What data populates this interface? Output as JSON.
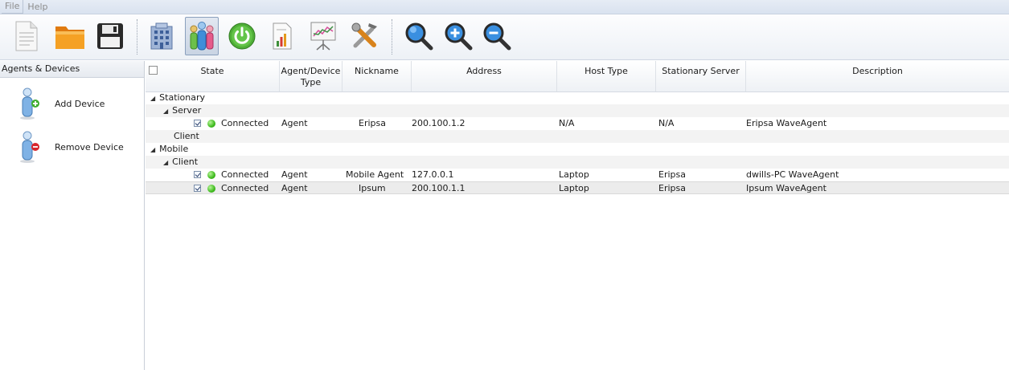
{
  "menu": {
    "file": "File",
    "help": "Help"
  },
  "toolbar": {
    "icons": [
      "new-document-icon",
      "open-folder-icon",
      "save-disk-icon",
      "building-icon",
      "agents-devices-icon",
      "power-icon",
      "report-icon",
      "chart-presentation-icon",
      "tools-icon",
      "search-icon",
      "zoom-in-icon",
      "zoom-out-icon"
    ],
    "active": "agents-devices-icon"
  },
  "sidebar": {
    "title": "Agents & Devices",
    "add_device": "Add Device",
    "remove_device": "Remove Device"
  },
  "grid": {
    "columns": [
      "State",
      "Agent/Device Type",
      "Nickname",
      "Address",
      "Host Type",
      "Stationary Server",
      "Description"
    ],
    "groups": {
      "stationary": "Stationary",
      "server": "Server",
      "client": "Client",
      "mobile": "Mobile",
      "mobile_client": "Client"
    },
    "rows": [
      {
        "state": "Connected",
        "type": "Agent",
        "nickname": "Eripsa",
        "address": "200.100.1.2",
        "host": "N/A",
        "server": "N/A",
        "description": "Eripsa WaveAgent"
      },
      {
        "state": "Connected",
        "type": "Agent",
        "nickname": "Mobile Agent",
        "address": "127.0.0.1",
        "host": "Laptop",
        "server": "Eripsa",
        "description": "dwills-PC WaveAgent"
      },
      {
        "state": "Connected",
        "type": "Agent",
        "nickname": "Ipsum",
        "address": "200.100.1.1",
        "host": "Laptop",
        "server": "Eripsa",
        "description": "Ipsum WaveAgent"
      }
    ]
  },
  "colors": {
    "connected": "#3fbb1e",
    "accent": "#1f7fd6"
  }
}
